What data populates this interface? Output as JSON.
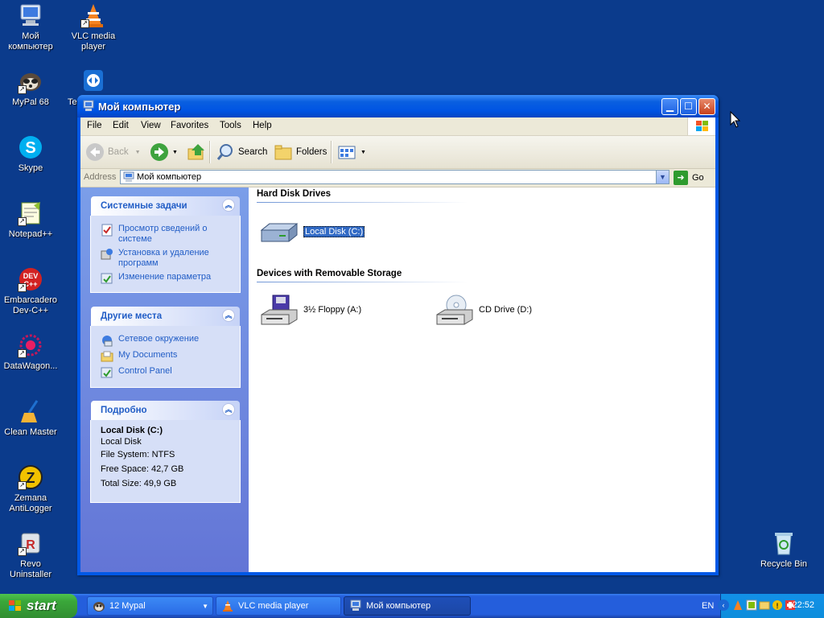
{
  "desktop": {
    "icons": [
      {
        "label": "Мой\nкомпьютер"
      },
      {
        "label": "VLC media\nplayer"
      },
      {
        "label": "MyPal 68"
      },
      {
        "label": "Te"
      },
      {
        "label": "Skype"
      },
      {
        "label": "Notepad++"
      },
      {
        "label": "Embarcadero\nDev-C++"
      },
      {
        "label": "DataWagon..."
      },
      {
        "label": "Clean Master"
      },
      {
        "label": "Zemana\nAntiLogger"
      },
      {
        "label": "Revo\nUninstaller"
      },
      {
        "label": "Recycle Bin"
      }
    ]
  },
  "window": {
    "title": "Мой компьютер",
    "menu": [
      "File",
      "Edit",
      "View",
      "Favorites",
      "Tools",
      "Help"
    ],
    "toolbar": {
      "back": "Back",
      "search": "Search",
      "folders": "Folders"
    },
    "address": {
      "label": "Address",
      "value": "Мой компьютер",
      "go": "Go"
    },
    "left_panels": {
      "system_tasks": {
        "title": "Системные задачи",
        "items": [
          "Просмотр сведений о системе",
          "Установка и удаление программ",
          "Изменение параметра"
        ]
      },
      "other_places": {
        "title": "Другие места",
        "items": [
          "Сетевое окружение",
          "My Documents",
          "Control Panel"
        ]
      },
      "details": {
        "title": "Подробно",
        "name": "Local Disk (C:)",
        "type": "Local Disk",
        "file_system": "File System: NTFS",
        "free_space": "Free Space: 42,7 GB",
        "total_size": "Total Size: 49,9 GB"
      }
    },
    "content": {
      "hard_disk_title": "Hard Disk Drives",
      "local_disk": "Local Disk (C:)",
      "removable_title": "Devices with Removable Storage",
      "floppy": "3½ Floppy (A:)",
      "cd": "CD Drive (D:)"
    }
  },
  "taskbar": {
    "start": "start",
    "tasks": [
      {
        "label": "12 Mypal"
      },
      {
        "label": "VLC media player"
      },
      {
        "label": "Мой компьютер"
      }
    ],
    "lang": "EN",
    "clock": "22:52"
  },
  "colors": {
    "desktop_bg": "#0b3b8c",
    "title_bar": "#0054e3",
    "task_link": "#215dc6",
    "selection": "#316ac5"
  }
}
